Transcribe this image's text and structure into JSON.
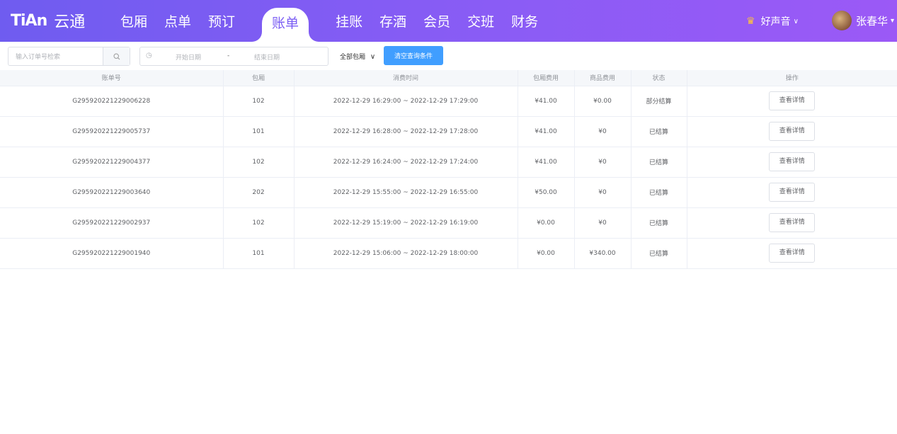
{
  "brand": {
    "mark": "TiAn",
    "name": "云通"
  },
  "nav": [
    {
      "label": "包厢"
    },
    {
      "label": "点单"
    },
    {
      "label": "预订"
    },
    {
      "label": "账单",
      "active": true
    },
    {
      "label": "挂账"
    },
    {
      "label": "存酒"
    },
    {
      "label": "会员"
    },
    {
      "label": "交班"
    },
    {
      "label": "财务"
    }
  ],
  "store": {
    "name": "好声音"
  },
  "user": {
    "name": "张春华"
  },
  "filters": {
    "search_placeholder": "输入订单号检索",
    "start_placeholder": "开始日期",
    "separator": "-",
    "end_placeholder": "结束日期",
    "room_select": "全部包厢",
    "clear_button": "清空查询条件"
  },
  "table": {
    "headers": [
      "账单号",
      "包厢",
      "消费时间",
      "包厢费用",
      "商品费用",
      "状态",
      "操作"
    ],
    "action_label": "查看详情",
    "rows": [
      {
        "bill": "G295920221229006228",
        "room": "102",
        "time": "2022-12-29 16:29:00 ~ 2022-12-29 17:29:00",
        "room_fee": "¥41.00",
        "goods_fee": "¥0.00",
        "status": "部分结算"
      },
      {
        "bill": "G295920221229005737",
        "room": "101",
        "time": "2022-12-29 16:28:00 ~ 2022-12-29 17:28:00",
        "room_fee": "¥41.00",
        "goods_fee": "¥0",
        "status": "已结算"
      },
      {
        "bill": "G295920221229004377",
        "room": "102",
        "time": "2022-12-29 16:24:00 ~ 2022-12-29 17:24:00",
        "room_fee": "¥41.00",
        "goods_fee": "¥0",
        "status": "已结算"
      },
      {
        "bill": "G295920221229003640",
        "room": "202",
        "time": "2022-12-29 15:55:00 ~ 2022-12-29 16:55:00",
        "room_fee": "¥50.00",
        "goods_fee": "¥0",
        "status": "已结算"
      },
      {
        "bill": "G295920221229002937",
        "room": "102",
        "time": "2022-12-29 15:19:00 ~ 2022-12-29 16:19:00",
        "room_fee": "¥0.00",
        "goods_fee": "¥0",
        "status": "已结算"
      },
      {
        "bill": "G295920221229001940",
        "room": "101",
        "time": "2022-12-29 15:06:00 ~ 2022-12-29 18:00:00",
        "room_fee": "¥0.00",
        "goods_fee": "¥340.00",
        "status": "已结算"
      }
    ]
  }
}
